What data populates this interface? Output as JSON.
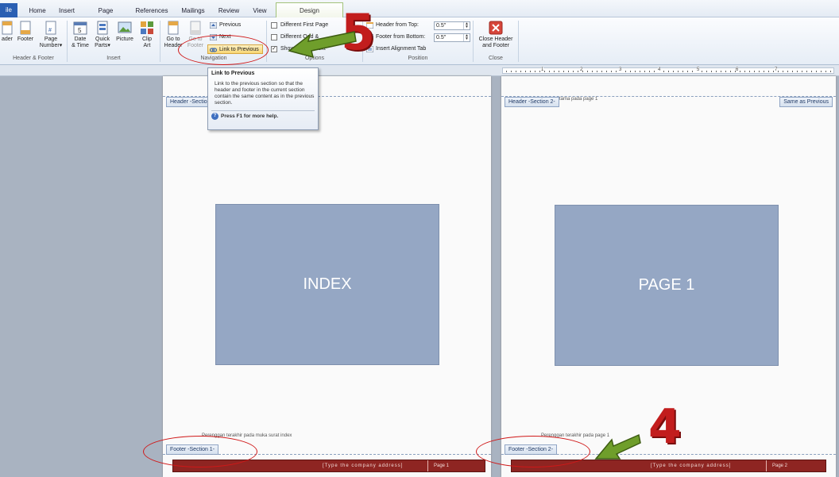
{
  "tabs": {
    "file": "ile",
    "home": "Home",
    "insert": "Insert",
    "page_layout": "Page Layout",
    "references": "References",
    "mailings": "Mailings",
    "review": "Review",
    "view": "View",
    "design": "Design"
  },
  "ribbon": {
    "header_footer": {
      "header": "ader",
      "footer": "Footer",
      "page_number_1": "Page",
      "page_number_2": "Number",
      "label": "Header & Footer"
    },
    "insert": {
      "date_1": "Date",
      "date_2": "& Time",
      "quick_1": "Quick",
      "quick_2": "Parts",
      "picture": "Picture",
      "clip_1": "Clip",
      "clip_2": "Art",
      "label": "Insert"
    },
    "navigation": {
      "goto_header_1": "Go to",
      "goto_header_2": "Header",
      "goto_footer_1": "Go to",
      "goto_footer_2": "Footer",
      "previous": "Previous",
      "next": "Next",
      "link_to_previous": "Link to Previous",
      "label": "Navigation"
    },
    "options": {
      "different_first_page": "Different First Page",
      "different_odd_even": "Different Odd &",
      "show_document_text": "Show",
      "show_document_text_tail": "Text",
      "label": "Options"
    },
    "position": {
      "header_from_top": "Header from Top:",
      "header_from_top_value": "0.5\"",
      "footer_from_bottom": "Footer from Bottom:",
      "footer_from_bottom_value": "0.5\"",
      "insert_alignment_tab": "Insert Alignment Tab",
      "label": "Position"
    },
    "close": {
      "close_1": "Close Header",
      "close_2": "and Footer",
      "label": "Close"
    }
  },
  "ruler": {
    "numbers": [
      "1",
      "2",
      "3",
      "4",
      "5",
      "6",
      "7"
    ]
  },
  "tooltip": {
    "title": "Link to Previous",
    "body": "Link to the previous section so that the header and footer in the current section contain the same content as in the previous section.",
    "help": "Press F1 for more help."
  },
  "page1": {
    "header_tag": "Header -Section",
    "image_label": "INDEX",
    "footer_text": "Perenggan terakhir pada muka surat index",
    "footer_tag": "Footer -Section 1-",
    "footer_address": "[Type the company address]",
    "footer_page": "Page 1"
  },
  "page2": {
    "header_tag": "Header -Section 2-",
    "header_text": "tama pada page 1",
    "same_as_previous": "Same as Previous",
    "image_label": "PAGE 1",
    "footer_text": "Perenggan terakhir pada page 1",
    "footer_tag": "Footer -Section 2-",
    "footer_address": "[Type the company address]",
    "footer_page": "Page 2"
  },
  "annotations": {
    "step_5": "5",
    "step_4": "4"
  },
  "colors": {
    "accent_green": "#7fae3a",
    "annotation_red": "#c21d1d",
    "footer_bar": "#8e2522"
  }
}
